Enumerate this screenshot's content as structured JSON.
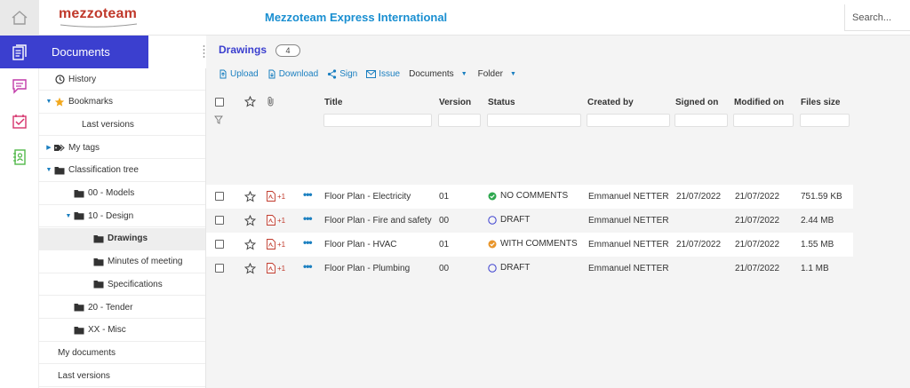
{
  "header": {
    "logo_text": "mezzoteam",
    "app_title": "Mezzoteam Express International",
    "search_placeholder": "Search..."
  },
  "rail": {
    "active_section_label": "Documents"
  },
  "tree": {
    "items": [
      {
        "label": "History",
        "icon": "clock-icon",
        "indent": 0,
        "caret": ""
      },
      {
        "label": "Bookmarks",
        "icon": "star-icon",
        "indent": 0,
        "caret": "down"
      },
      {
        "label": "Last versions",
        "icon": "",
        "indent": 1,
        "caret": ""
      },
      {
        "label": "My tags",
        "icon": "tags-icon",
        "indent": 0,
        "caret": "right"
      },
      {
        "label": "Classification tree",
        "icon": "folder-icon",
        "indent": 0,
        "caret": "down"
      },
      {
        "label": "00 - Models",
        "icon": "folder-icon",
        "indent": 1,
        "caret": ""
      },
      {
        "label": "10 - Design",
        "icon": "folder-icon",
        "indent": 1,
        "caret": "down"
      },
      {
        "label": "Drawings",
        "icon": "folder-icon",
        "indent": 2,
        "caret": "",
        "selected": true
      },
      {
        "label": "Minutes of meeting",
        "icon": "folder-icon",
        "indent": 2,
        "caret": ""
      },
      {
        "label": "Specifications",
        "icon": "folder-icon",
        "indent": 2,
        "caret": ""
      },
      {
        "label": "20 - Tender",
        "icon": "folder-icon",
        "indent": 1,
        "caret": ""
      },
      {
        "label": "XX - Misc",
        "icon": "folder-icon",
        "indent": 1,
        "caret": ""
      },
      {
        "label": "My documents",
        "icon": "",
        "indent": -1,
        "caret": ""
      },
      {
        "label": "Last versions",
        "icon": "",
        "indent": -1,
        "caret": ""
      }
    ]
  },
  "main": {
    "breadcrumb": "Drawings",
    "count": "4",
    "toolbar": {
      "upload": "Upload",
      "download": "Download",
      "sign": "Sign",
      "issue": "Issue",
      "documents": "Documents",
      "folder": "Folder"
    },
    "columns": {
      "title": "Title",
      "version": "Version",
      "status": "Status",
      "created_by": "Created by",
      "signed_on": "Signed on",
      "modified_on": "Modified on",
      "files_size": "Files size"
    },
    "rows": [
      {
        "title": "Floor Plan - Electricity",
        "attachments": "+1",
        "version": "01",
        "status": "NO COMMENTS",
        "status_kind": "ok",
        "created_by": "Emmanuel NETTER",
        "signed_on": "21/07/2022",
        "modified_on": "21/07/2022",
        "files_size": "751.59 KB"
      },
      {
        "title": "Floor Plan - Fire and safety",
        "attachments": "+1",
        "version": "00",
        "status": "DRAFT",
        "status_kind": "draft",
        "created_by": "Emmanuel NETTER",
        "signed_on": "",
        "modified_on": "21/07/2022",
        "files_size": "2.44 MB"
      },
      {
        "title": "Floor Plan - HVAC",
        "attachments": "+1",
        "version": "01",
        "status": "WITH COMMENTS",
        "status_kind": "warn",
        "created_by": "Emmanuel NETTER",
        "signed_on": "21/07/2022",
        "modified_on": "21/07/2022",
        "files_size": "1.55 MB"
      },
      {
        "title": "Floor Plan - Plumbing",
        "attachments": "+1",
        "version": "00",
        "status": "DRAFT",
        "status_kind": "draft",
        "created_by": "Emmanuel NETTER",
        "signed_on": "",
        "modified_on": "21/07/2022",
        "files_size": "1.1 MB"
      }
    ]
  },
  "colors": {
    "accent": "#3b3fcf",
    "link": "#1a7fc0",
    "title": "#1a8fd1",
    "ok": "#2ea84f",
    "warn": "#e8952a",
    "draft": "#3b3fcf"
  }
}
